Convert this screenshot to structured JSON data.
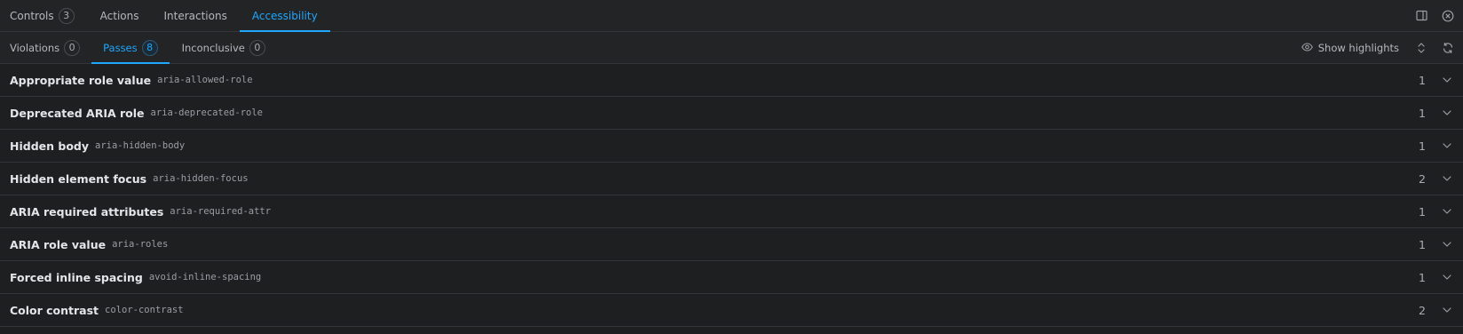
{
  "top_tabs": [
    {
      "label": "Controls",
      "count": "3"
    },
    {
      "label": "Actions"
    },
    {
      "label": "Interactions"
    },
    {
      "label": "Accessibility"
    }
  ],
  "top_tools": [
    "sidebar-toggle-icon",
    "close-circle-icon"
  ],
  "sub_tabs": [
    {
      "label": "Violations",
      "count": "0"
    },
    {
      "label": "Passes",
      "count": "8"
    },
    {
      "label": "Inconclusive",
      "count": "0"
    }
  ],
  "show_highlights": {
    "label": "Show highlights",
    "icon": "eye-icon"
  },
  "sub_tools": [
    "expand-collapse-icon",
    "rerun-icon"
  ],
  "accent_color": "#1ea7fd",
  "rows": [
    {
      "title": "Appropriate role value",
      "id": "aria-allowed-role",
      "count": "1"
    },
    {
      "title": "Deprecated ARIA role",
      "id": "aria-deprecated-role",
      "count": "1"
    },
    {
      "title": "Hidden body",
      "id": "aria-hidden-body",
      "count": "1"
    },
    {
      "title": "Hidden element focus",
      "id": "aria-hidden-focus",
      "count": "2"
    },
    {
      "title": "ARIA required attributes",
      "id": "aria-required-attr",
      "count": "1"
    },
    {
      "title": "ARIA role value",
      "id": "aria-roles",
      "count": "1"
    },
    {
      "title": "Forced inline spacing",
      "id": "avoid-inline-spacing",
      "count": "1"
    },
    {
      "title": "Color contrast",
      "id": "color-contrast",
      "count": "2"
    }
  ]
}
